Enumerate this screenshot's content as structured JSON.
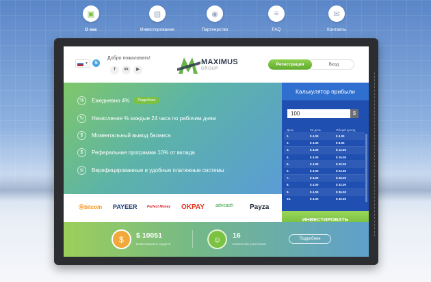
{
  "nav": [
    {
      "label": "О нас",
      "icon": "briefcase-icon",
      "glyph": "▣",
      "active": true
    },
    {
      "label": "Инвестирование",
      "icon": "wallet-icon",
      "glyph": "▤",
      "active": false
    },
    {
      "label": "Партнерство",
      "icon": "user-icon",
      "glyph": "◉",
      "active": false
    },
    {
      "label": "FAQ",
      "icon": "menu-icon",
      "glyph": "≡",
      "active": false
    },
    {
      "label": "Контакты",
      "icon": "mail-icon",
      "glyph": "✉",
      "active": false
    }
  ],
  "header": {
    "welcome": "Добро пожаловать!",
    "social": [
      "f",
      "vk",
      "▶"
    ],
    "logo_main": "MAXIMUS",
    "logo_sub": "GROUP",
    "register": "Регистрация",
    "login": "Вход"
  },
  "features": [
    {
      "text": "Ежедневно 4%",
      "badge": "Подробнее",
      "glyph": "%"
    },
    {
      "text": "Начисление % каждые 24 часа по рабочим дням",
      "glyph": "↻"
    },
    {
      "text": "Моментальный вывод баланса",
      "glyph": "$"
    },
    {
      "text": "Реферальная программа 10% от вклада",
      "glyph": "$"
    },
    {
      "text": "Верефицированные и удобные платежные системы",
      "glyph": "◎"
    }
  ],
  "calculator": {
    "title": "Калькулятор прибыли",
    "amount": "100",
    "currency": "$",
    "columns": [
      "День",
      "За день",
      "Общий доход"
    ],
    "rows": [
      [
        "1.",
        "$ 4.00",
        "$ 4.00"
      ],
      [
        "2.",
        "$ 4.00",
        "$ 8.00"
      ],
      [
        "3.",
        "$ 4.00",
        "$ 12.00"
      ],
      [
        "4.",
        "$ 4.00",
        "$ 16.00"
      ],
      [
        "5.",
        "$ 4.00",
        "$ 20.00"
      ],
      [
        "6.",
        "$ 4.00",
        "$ 24.00"
      ],
      [
        "7.",
        "$ 4.00",
        "$ 28.00"
      ],
      [
        "8.",
        "$ 4.00",
        "$ 32.00"
      ],
      [
        "9.",
        "$ 4.00",
        "$ 36.00"
      ],
      [
        "10.",
        "$ 4.00",
        "$ 40.00"
      ]
    ],
    "invest_button": "ИНВЕСТИРОВАТЬ"
  },
  "payments": [
    {
      "label": "Ⓑbitcoin",
      "color": "#f7931a"
    },
    {
      "label": "PAYEER",
      "color": "#1b3d6e"
    },
    {
      "label": "Perfect Money",
      "color": "#d2232a"
    },
    {
      "label": "OKPAY",
      "color": "#e2321b"
    },
    {
      "label": "advcash",
      "color": "#3aa24a"
    },
    {
      "label": "Payza",
      "color": "#222b3a"
    }
  ],
  "stats": {
    "invested_value": "$ 10051",
    "invested_label": "Инвестировано средств",
    "members_value": "16",
    "members_label": "Количество участников",
    "more_button": "Подробнее"
  }
}
